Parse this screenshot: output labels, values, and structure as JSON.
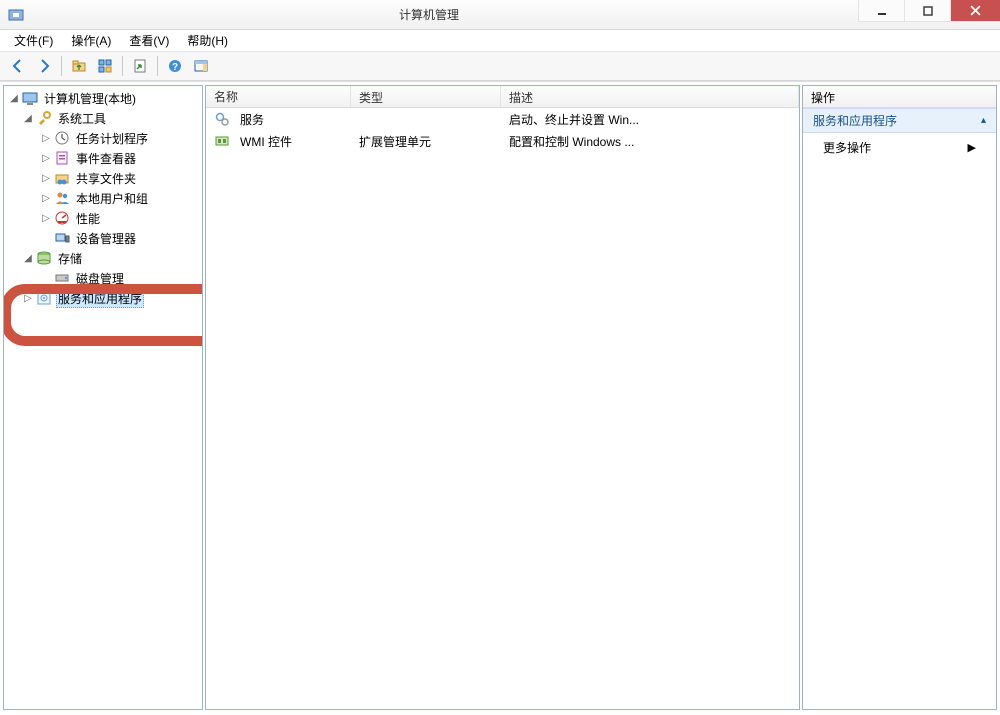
{
  "window": {
    "title": "计算机管理"
  },
  "menu": {
    "file": "文件(F)",
    "action": "操作(A)",
    "view": "查看(V)",
    "help": "帮助(H)"
  },
  "toolbar_icons": {
    "back": "back-icon",
    "forward": "forward-icon",
    "up": "up-icon",
    "props": "properties-icon",
    "refresh": "refresh-icon",
    "export": "export-icon",
    "help": "help-icon",
    "show": "show-hide-icon"
  },
  "tree": {
    "root": "计算机管理(本地)",
    "system_tools": "系统工具",
    "task_scheduler": "任务计划程序",
    "event_viewer": "事件查看器",
    "shared_folders": "共享文件夹",
    "local_users": "本地用户和组",
    "performance": "性能",
    "device_manager": "设备管理器",
    "storage": "存储",
    "disk_management": "磁盘管理",
    "services_apps": "服务和应用程序"
  },
  "list": {
    "columns": {
      "name": "名称",
      "type": "类型",
      "desc": "描述"
    },
    "rows": [
      {
        "name": "服务",
        "type": "",
        "desc": "启动、终止并设置 Win...",
        "icon": "gears-icon"
      },
      {
        "name": "WMI 控件",
        "type": "扩展管理单元",
        "desc": "配置和控制 Windows ...",
        "icon": "wmi-icon"
      }
    ]
  },
  "actions": {
    "header": "操作",
    "section": "服务和应用程序",
    "more": "更多操作"
  }
}
